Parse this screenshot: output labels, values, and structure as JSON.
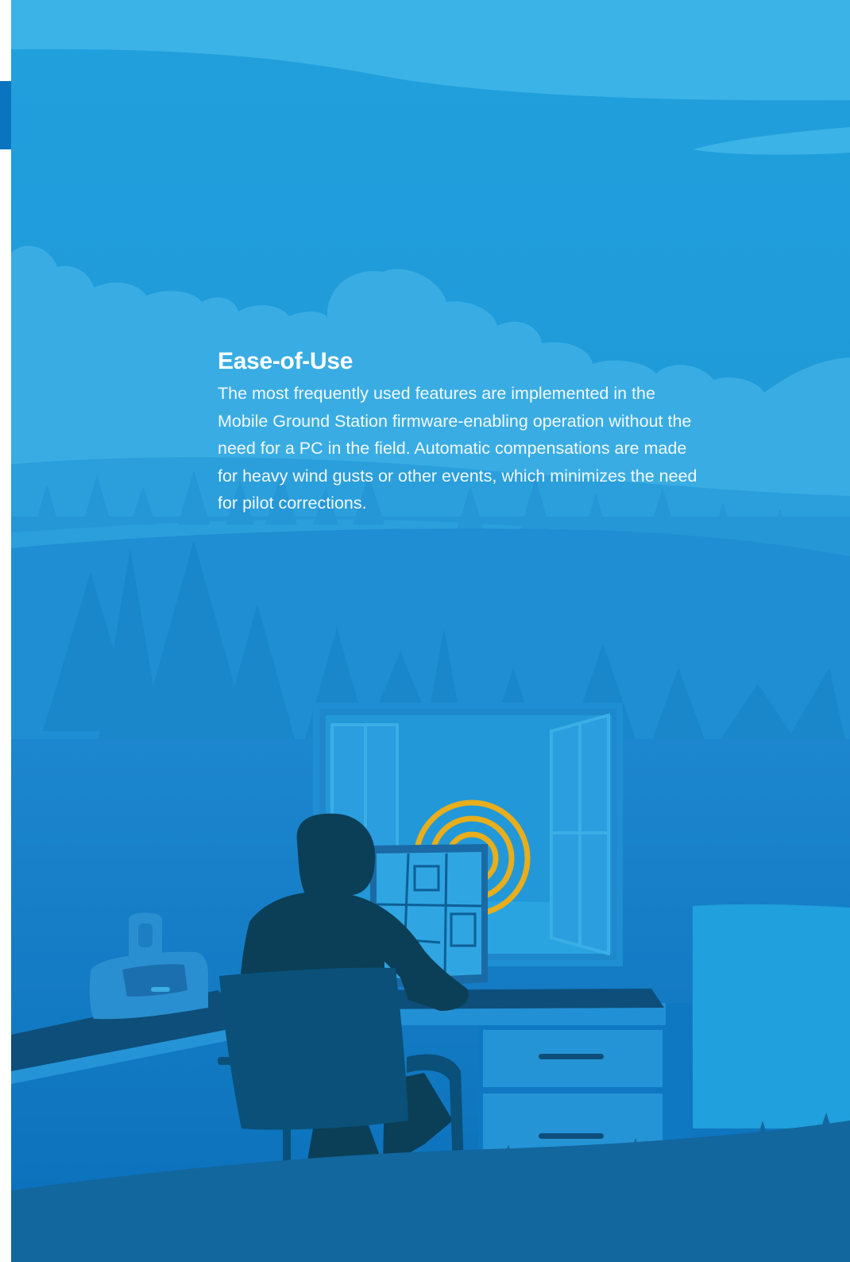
{
  "section": {
    "heading": "Ease-of-Use",
    "body": "The most frequently used features are implemented in the Mobile Ground Station firmware-enabling operation without the need for a PC in the field. Automatic compensations are made for heavy wind gusts or other events, which minimizes the need for pilot corrections."
  },
  "illustration": {
    "elements": [
      "sky",
      "clouds",
      "forest",
      "open-window",
      "person-at-desk",
      "laptop-map",
      "signal-icon",
      "printer",
      "chair",
      "desk-drawers",
      "grass"
    ]
  },
  "colors": {
    "sky": "#3bb3e6",
    "deep": "#0a74c0",
    "silhouette": "#0b3f57",
    "signal": "#e8ae1c"
  }
}
